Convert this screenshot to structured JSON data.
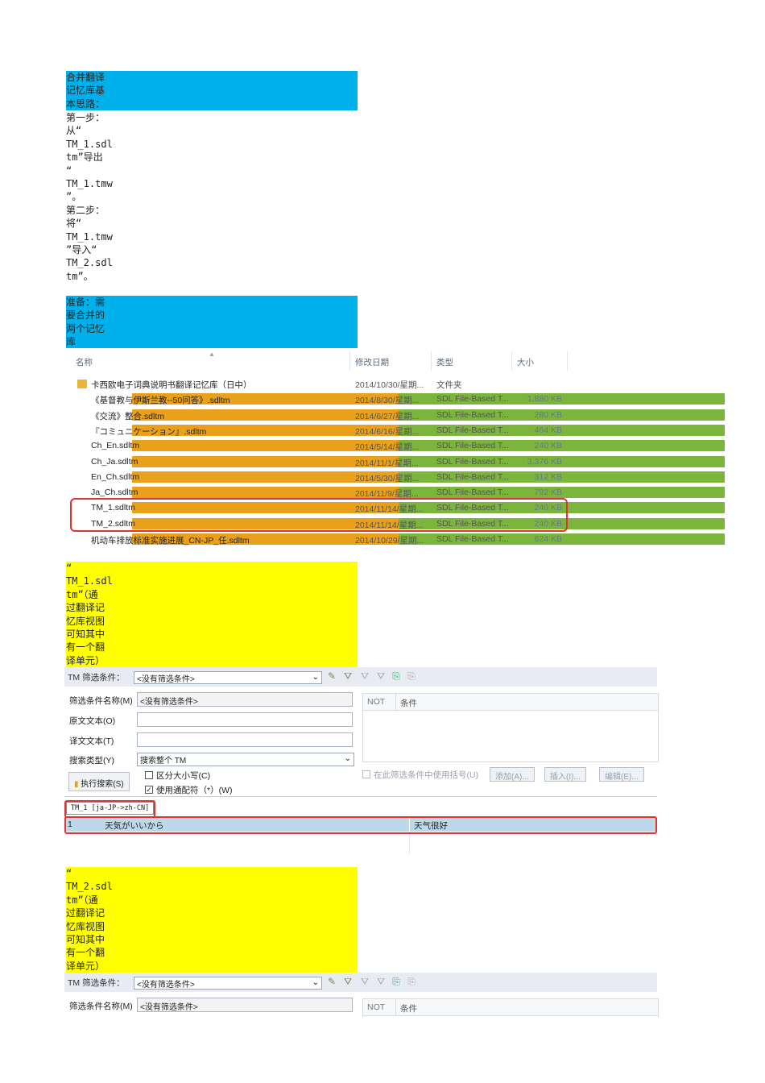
{
  "note1": {
    "lines": [
      "合并翻译",
      "记忆库基",
      "本思路："
    ]
  },
  "steps": {
    "lines": [
      "第一步：",
      "从“",
      "TM_1.sdl",
      "tm”导出",
      "“",
      "TM_1.tmw",
      "”。",
      "第二步：",
      "将“",
      "TM_1.tmw",
      "”导入“",
      "TM_2.sdl",
      "tm”。"
    ]
  },
  "note2": {
    "lines": [
      "准备：需",
      "要合并的",
      "两个记忆",
      "库"
    ]
  },
  "explorer": {
    "headers": {
      "name": "名称",
      "date": "修改日期",
      "type": "类型",
      "size": "大小"
    },
    "files": [
      {
        "icon": "folder-icon",
        "name": "卡西欧电子词典说明书翻译记忆库（日中）",
        "date": "2014/10/30/星期...",
        "type": "文件夹",
        "size": ""
      },
      {
        "icon": "tm-file-icon",
        "name": "《基督教与伊斯兰教--50问答》.sdltm",
        "date": "2014/8/30/星期...",
        "type": "SDL File-Based T...",
        "size": "1,880 KB"
      },
      {
        "icon": "tm-file-icon",
        "name": "《交流》整合.sdltm",
        "date": "2014/6/27/星期...",
        "type": "SDL File-Based T...",
        "size": "280 KB"
      },
      {
        "icon": "tm-file-icon",
        "name": "『コミュニケーション』.sdltm",
        "date": "2014/6/16/星期...",
        "type": "SDL File-Based T...",
        "size": "464 KB"
      },
      {
        "icon": "tm-file-icon",
        "name": "Ch_En.sdltm",
        "date": "2014/5/14/星期...",
        "type": "SDL File-Based T...",
        "size": "240 KB"
      },
      {
        "icon": "tm-file-icon",
        "name": "Ch_Ja.sdltm",
        "date": "2014/11/1/星期...",
        "type": "SDL File-Based T...",
        "size": "3,376 KB"
      },
      {
        "icon": "tm-file-icon",
        "name": "En_Ch.sdltm",
        "date": "2014/5/30/星期...",
        "type": "SDL File-Based T...",
        "size": "312 KB"
      },
      {
        "icon": "tm-file-icon",
        "name": "Ja_Ch.sdltm",
        "date": "2014/11/9/星期...",
        "type": "SDL File-Based T...",
        "size": "792 KB"
      },
      {
        "icon": "tm-file-icon",
        "name": "TM_1.sdltm",
        "date": "2014/11/14/星期...",
        "type": "SDL File-Based T...",
        "size": "240 KB"
      },
      {
        "icon": "tm-file-icon",
        "name": "TM_2.sdltm",
        "date": "2014/11/14/星期...",
        "type": "SDL File-Based T...",
        "size": "240 KB"
      },
      {
        "icon": "tm-file-icon",
        "name": "机动车排放标准实施进展_CN-JP_任.sdltm",
        "date": "2014/10/29/星期...",
        "type": "SDL File-Based T...",
        "size": "624 KB"
      }
    ]
  },
  "note3": {
    "lines": [
      "“",
      "TM_1.sdl",
      "tm”（通",
      "过翻译记",
      "忆库视图",
      "可知其中",
      "有一个翻",
      "译单元）"
    ]
  },
  "tmview1": {
    "filter_label": "TM 筛选条件：",
    "filter_value": "<没有筛选条件>",
    "filter_name_label": "筛选条件名称(M)",
    "filter_name_value": "<没有筛选条件>",
    "source_label": "原文文本(O)",
    "target_label": "译文文本(T)",
    "search_type_label": "搜索类型(Y)",
    "search_type_value": "搜索整个 TM",
    "run_search": "执行搜索(S)",
    "case_label": "区分大小写(C)",
    "wildcard_label": "使用通配符（*）(W)",
    "not_col": "NOT",
    "cond_col": "条件",
    "paren_label": "在此筛选条件中使用括号(U)",
    "add_btn": "添加(A)...",
    "insert_btn": "插入(I)...",
    "edit_btn": "编辑(E)...",
    "tab_label": "TM_1 [ja-JP->zh-CN]",
    "segment": {
      "number": "1",
      "source": "天気がいいから",
      "target": "天气很好"
    }
  },
  "note4": {
    "lines": [
      "“",
      "TM_2.sdl",
      "tm”（通",
      "过翻译记",
      "忆库视图",
      "可知其中",
      "有一个翻",
      "译单元）"
    ]
  },
  "tmview2": {
    "filter_label": "TM 筛选条件：",
    "filter_value": "<没有筛选条件>",
    "filter_name_label": "筛选条件名称(M)",
    "filter_name_value": "<没有筛选条件>",
    "not_col": "NOT",
    "cond_col": "条件"
  }
}
